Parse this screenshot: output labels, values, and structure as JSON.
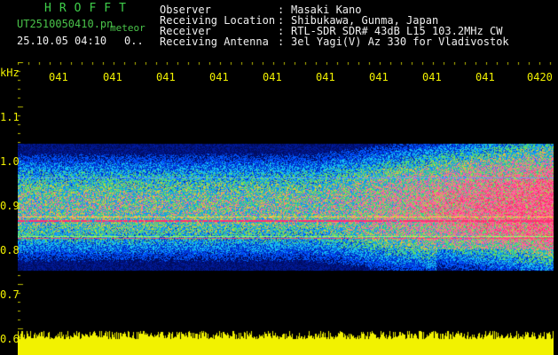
{
  "header": {
    "brand": "HROFFT",
    "filename": "UT2510050410.pn",
    "filename_suffix": "meteor",
    "datetime": "25.10.05 04:10",
    "counter": "0..",
    "fields": [
      {
        "label": "Observer",
        "sep": ":",
        "value": "Masaki Kano"
      },
      {
        "label": "Receiving Location",
        "sep": ":",
        "value": "Shibukawa, Gunma, Japan"
      },
      {
        "label": "Receiver",
        "sep": ":",
        "value": "RTL-SDR SDR# 43dB L15 103.2MHz CW"
      },
      {
        "label": "Receiving Antenna",
        "sep": ":",
        "value": "3el Yagi(V) Az 330 for Vladivostok"
      }
    ]
  },
  "axis": {
    "unit": "kHz",
    "y_labels": [
      "1.1",
      "1.0",
      "0.9",
      "0.8",
      "0.7",
      "0.6"
    ],
    "time_labels": [
      "041",
      "041",
      "041",
      "041",
      "041",
      "041",
      "041",
      "041",
      "041",
      "0420"
    ]
  },
  "colors": {
    "text_label": "#f0f0f0",
    "brand": "#3fd04a",
    "axis": "#f2f200",
    "signal_low": "#0010a0",
    "signal_mid": "#1090ff",
    "signal_high": "#ff2a60",
    "signal_peak": "#f2f200"
  }
}
